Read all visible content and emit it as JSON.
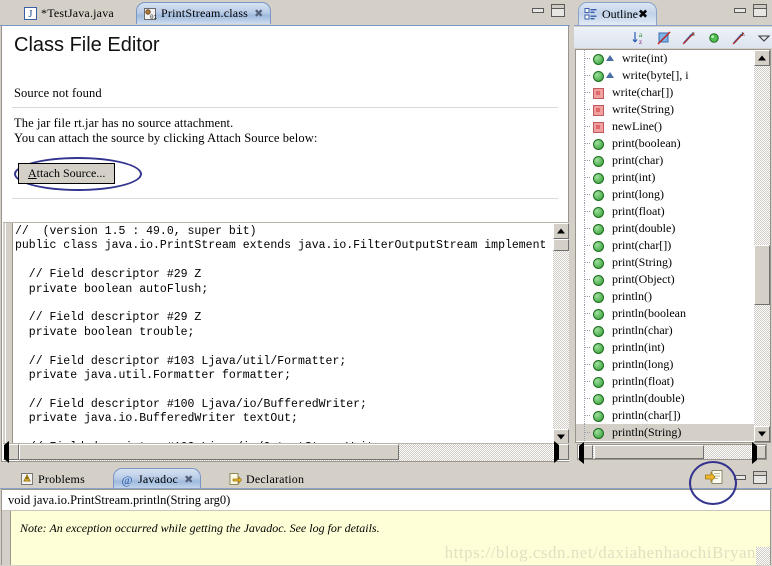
{
  "editor": {
    "tabs": [
      {
        "label": "*TestJava.java",
        "icon": "java-file-icon",
        "active": false,
        "closable": false
      },
      {
        "label": "PrintStream.class",
        "icon": "class-file-icon",
        "active": true,
        "closable": true
      }
    ],
    "heading": "Class File Editor",
    "messages": [
      "Source not found",
      "The jar file rt.jar has no source attachment.",
      "You can attach the source by clicking Attach Source below:"
    ],
    "attach_button": {
      "label": "Attach Source...",
      "mnemonic": "A",
      "annotated": true
    },
    "bytecode": "//  (version 1.5 : 49.0, super bit)\npublic class java.io.PrintStream extends java.io.FilterOutputStream implements java.lang.\n\n  // Field descriptor #29 Z\n  private boolean autoFlush;\n\n  // Field descriptor #29 Z\n  private boolean trouble;\n\n  // Field descriptor #103 Ljava/util/Formatter;\n  private java.util.Formatter formatter;\n\n  // Field descriptor #100 Ljava/io/BufferedWriter;\n  private java.io.BufferedWriter textOut;\n\n  // Field descriptor #102 Ljava/io/OutputStreamWriter;\n  private java.io.OutputStreamWriter charOut;\n\n  // Field descriptor #29 Z\n  private boolean closing;"
  },
  "outline": {
    "title": "Outline",
    "icon": "outline-view-icon",
    "closable": true,
    "toolbar": [
      {
        "name": "sort-alphabetically-icon"
      },
      {
        "name": "hide-fields-icon"
      },
      {
        "name": "hide-static-icon"
      },
      {
        "name": "hide-non-public-icon"
      },
      {
        "name": "hide-local-types-icon"
      },
      {
        "name": "view-menu-icon"
      }
    ],
    "items": [
      {
        "label": "write(int)",
        "mark": "public-method",
        "abstract": true,
        "selected": false
      },
      {
        "label": "write(byte[], i",
        "mark": "public-method",
        "abstract": true,
        "selected": false
      },
      {
        "label": "write(char[])",
        "mark": "private-method",
        "abstract": false,
        "selected": false
      },
      {
        "label": "write(String)",
        "mark": "private-method",
        "abstract": false,
        "selected": false
      },
      {
        "label": "newLine()",
        "mark": "private-method",
        "abstract": false,
        "selected": false
      },
      {
        "label": "print(boolean)",
        "mark": "public-method",
        "abstract": false,
        "selected": false
      },
      {
        "label": "print(char)",
        "mark": "public-method",
        "abstract": false,
        "selected": false
      },
      {
        "label": "print(int)",
        "mark": "public-method",
        "abstract": false,
        "selected": false
      },
      {
        "label": "print(long)",
        "mark": "public-method",
        "abstract": false,
        "selected": false
      },
      {
        "label": "print(float)",
        "mark": "public-method",
        "abstract": false,
        "selected": false
      },
      {
        "label": "print(double)",
        "mark": "public-method",
        "abstract": false,
        "selected": false
      },
      {
        "label": "print(char[])",
        "mark": "public-method",
        "abstract": false,
        "selected": false
      },
      {
        "label": "print(String)",
        "mark": "public-method",
        "abstract": false,
        "selected": false
      },
      {
        "label": "print(Object)",
        "mark": "public-method",
        "abstract": false,
        "selected": false
      },
      {
        "label": "println()",
        "mark": "public-method",
        "abstract": false,
        "selected": false
      },
      {
        "label": "println(boolean",
        "mark": "public-method",
        "abstract": false,
        "selected": false
      },
      {
        "label": "println(char)",
        "mark": "public-method",
        "abstract": false,
        "selected": false
      },
      {
        "label": "println(int)",
        "mark": "public-method",
        "abstract": false,
        "selected": false
      },
      {
        "label": "println(long)",
        "mark": "public-method",
        "abstract": false,
        "selected": false
      },
      {
        "label": "println(float)",
        "mark": "public-method",
        "abstract": false,
        "selected": false
      },
      {
        "label": "println(double)",
        "mark": "public-method",
        "abstract": false,
        "selected": false
      },
      {
        "label": "println(char[])",
        "mark": "public-method",
        "abstract": false,
        "selected": false
      },
      {
        "label": "println(String)",
        "mark": "public-method",
        "abstract": false,
        "selected": true
      }
    ]
  },
  "bottom": {
    "tabs": [
      {
        "label": "Problems",
        "icon": "problems-icon",
        "active": false,
        "closable": false
      },
      {
        "label": "Javadoc",
        "icon": "javadoc-at-icon",
        "active": true,
        "closable": true
      },
      {
        "label": "Declaration",
        "icon": "declaration-icon",
        "active": false,
        "closable": false
      }
    ],
    "signature": "void java.io.PrintStream.println(String arg0)",
    "note": "Note: An exception occurred while getting the Javadoc. See log for details.",
    "export_icon": "open-javadoc-in-browser-icon",
    "export_annotated": true
  },
  "watermark": "https://blog.csdn.net/daxiahenhaochiBryan",
  "colors": {
    "chrome": "#d4d0c8",
    "tab_active_blue": "#b8cbe6",
    "annotation_blue": "#33348e",
    "javadoc_bg": "#feffd6",
    "public_method_green": "#2e9b2e",
    "private_method_red": "#e06a6a"
  }
}
